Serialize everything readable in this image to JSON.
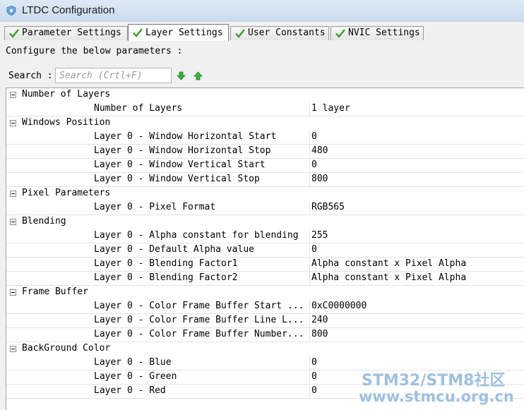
{
  "window": {
    "title": "LTDC Configuration"
  },
  "tabs": [
    {
      "label": "Parameter Settings",
      "active": false
    },
    {
      "label": "Layer Settings",
      "active": true
    },
    {
      "label": "User Constants",
      "active": false
    },
    {
      "label": "NVIC Settings",
      "active": false
    }
  ],
  "instructions": "Configure the below parameters :",
  "search": {
    "label": "Search :",
    "placeholder": "Search (Crtl+F)"
  },
  "groups": [
    {
      "label": "Number of Layers",
      "params": [
        {
          "name": "Number of Layers",
          "value": "1 layer"
        }
      ]
    },
    {
      "label": "Windows Position",
      "params": [
        {
          "name": "Layer 0 - Window Horizontal Start",
          "value": "0"
        },
        {
          "name": "Layer 0 - Window Horizontal Stop",
          "value": "480"
        },
        {
          "name": "Layer 0 - Window Vertical Start",
          "value": "0"
        },
        {
          "name": "Layer 0 - Window Vertical Stop",
          "value": "800"
        }
      ]
    },
    {
      "label": "Pixel Parameters",
      "params": [
        {
          "name": "Layer 0 - Pixel Format",
          "value": "RGB565"
        }
      ]
    },
    {
      "label": "Blending",
      "params": [
        {
          "name": "Layer 0 - Alpha constant for blending",
          "value": "255"
        },
        {
          "name": "Layer 0 - Default Alpha value",
          "value": "0"
        },
        {
          "name": "Layer 0 - Blending Factor1",
          "value": "Alpha constant x Pixel Alpha"
        },
        {
          "name": "Layer 0 - Blending Factor2",
          "value": "Alpha constant x Pixel Alpha"
        }
      ]
    },
    {
      "label": "Frame Buffer",
      "params": [
        {
          "name": "Layer 0 - Color Frame Buffer Start ...",
          "value": "0xC0000000"
        },
        {
          "name": "Layer 0 - Color Frame Buffer Line L...",
          "value": "240"
        },
        {
          "name": "Layer 0 - Color Frame Buffer Number...",
          "value": "800"
        }
      ]
    },
    {
      "label": "BackGround Color",
      "params": [
        {
          "name": "Layer 0 - Blue",
          "value": "0"
        },
        {
          "name": "Layer 0 - Green",
          "value": "0"
        },
        {
          "name": "Layer 0 - Red",
          "value": "0"
        }
      ]
    }
  ],
  "watermark": {
    "line1": "STM32/STM8社区",
    "line2": "www.stmcu.org.cn"
  },
  "colors": {
    "check": "#3a9a2a",
    "arrow": "#3bb03b"
  }
}
